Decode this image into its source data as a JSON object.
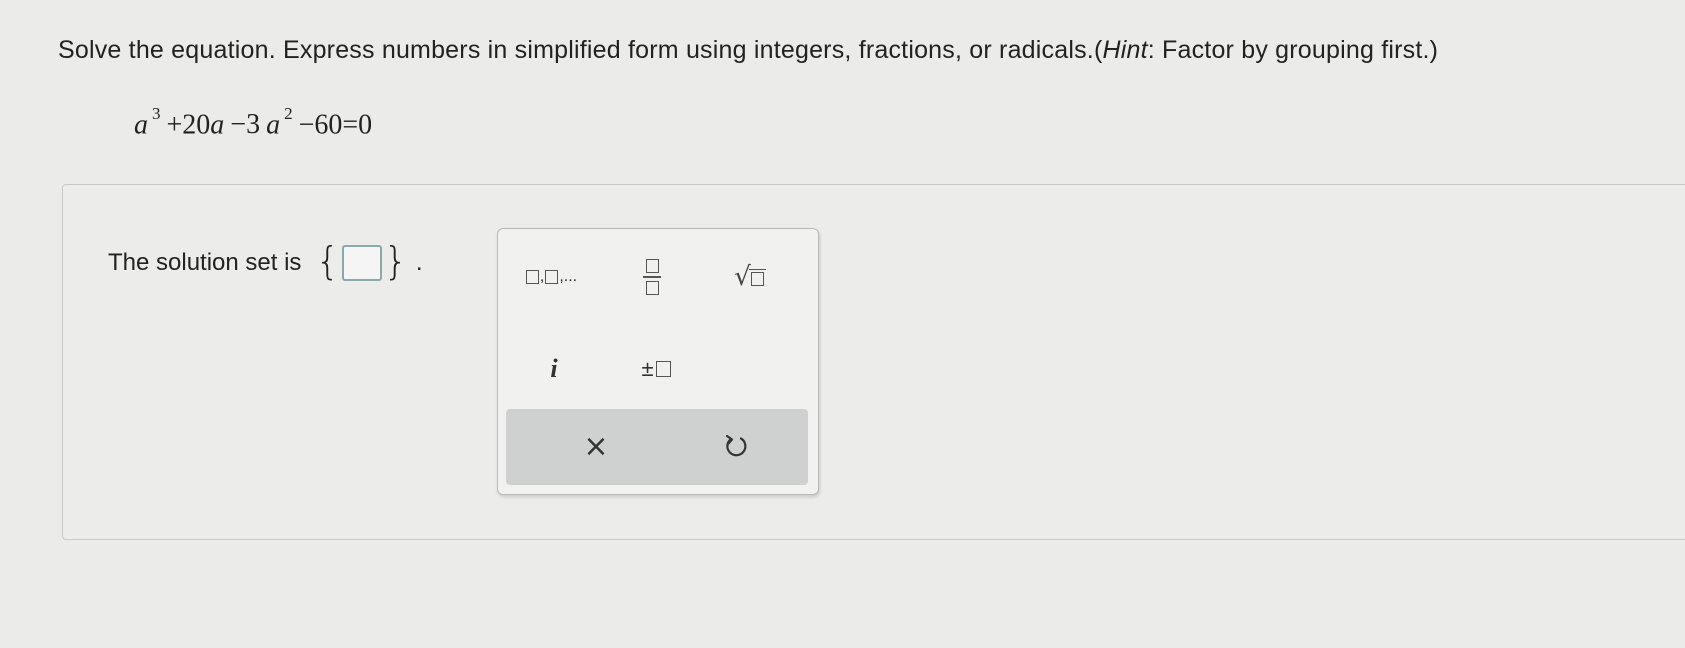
{
  "prompt": {
    "main": "Solve the equation. Express numbers in simplified form using integers, fractions, or radicals.(",
    "hint_label": "Hint",
    "hint_text": ": Factor by grouping first.)"
  },
  "equation": {
    "base1": "a",
    "exp1": "3",
    "term2": "+20",
    "var2": "a",
    "op3": "−3",
    "base3": "a",
    "exp3": "2",
    "rest": "−60=0"
  },
  "answer": {
    "label": "The solution set is",
    "brace_open": "{",
    "brace_close": "}",
    "period": ".",
    "value": ""
  },
  "palette": {
    "list_separator": ",",
    "list_ellipsis": "...",
    "sqrt_symbol": "√",
    "imaginary": "i",
    "plus_minus": "±",
    "clear": "×"
  },
  "icons": {
    "list": "list-template-icon",
    "fraction": "fraction-template-icon",
    "sqrt": "square-root-template-icon",
    "imaginary": "imaginary-unit-icon",
    "plus_minus": "plus-minus-template-icon",
    "clear": "clear-icon",
    "undo": "undo-icon"
  }
}
